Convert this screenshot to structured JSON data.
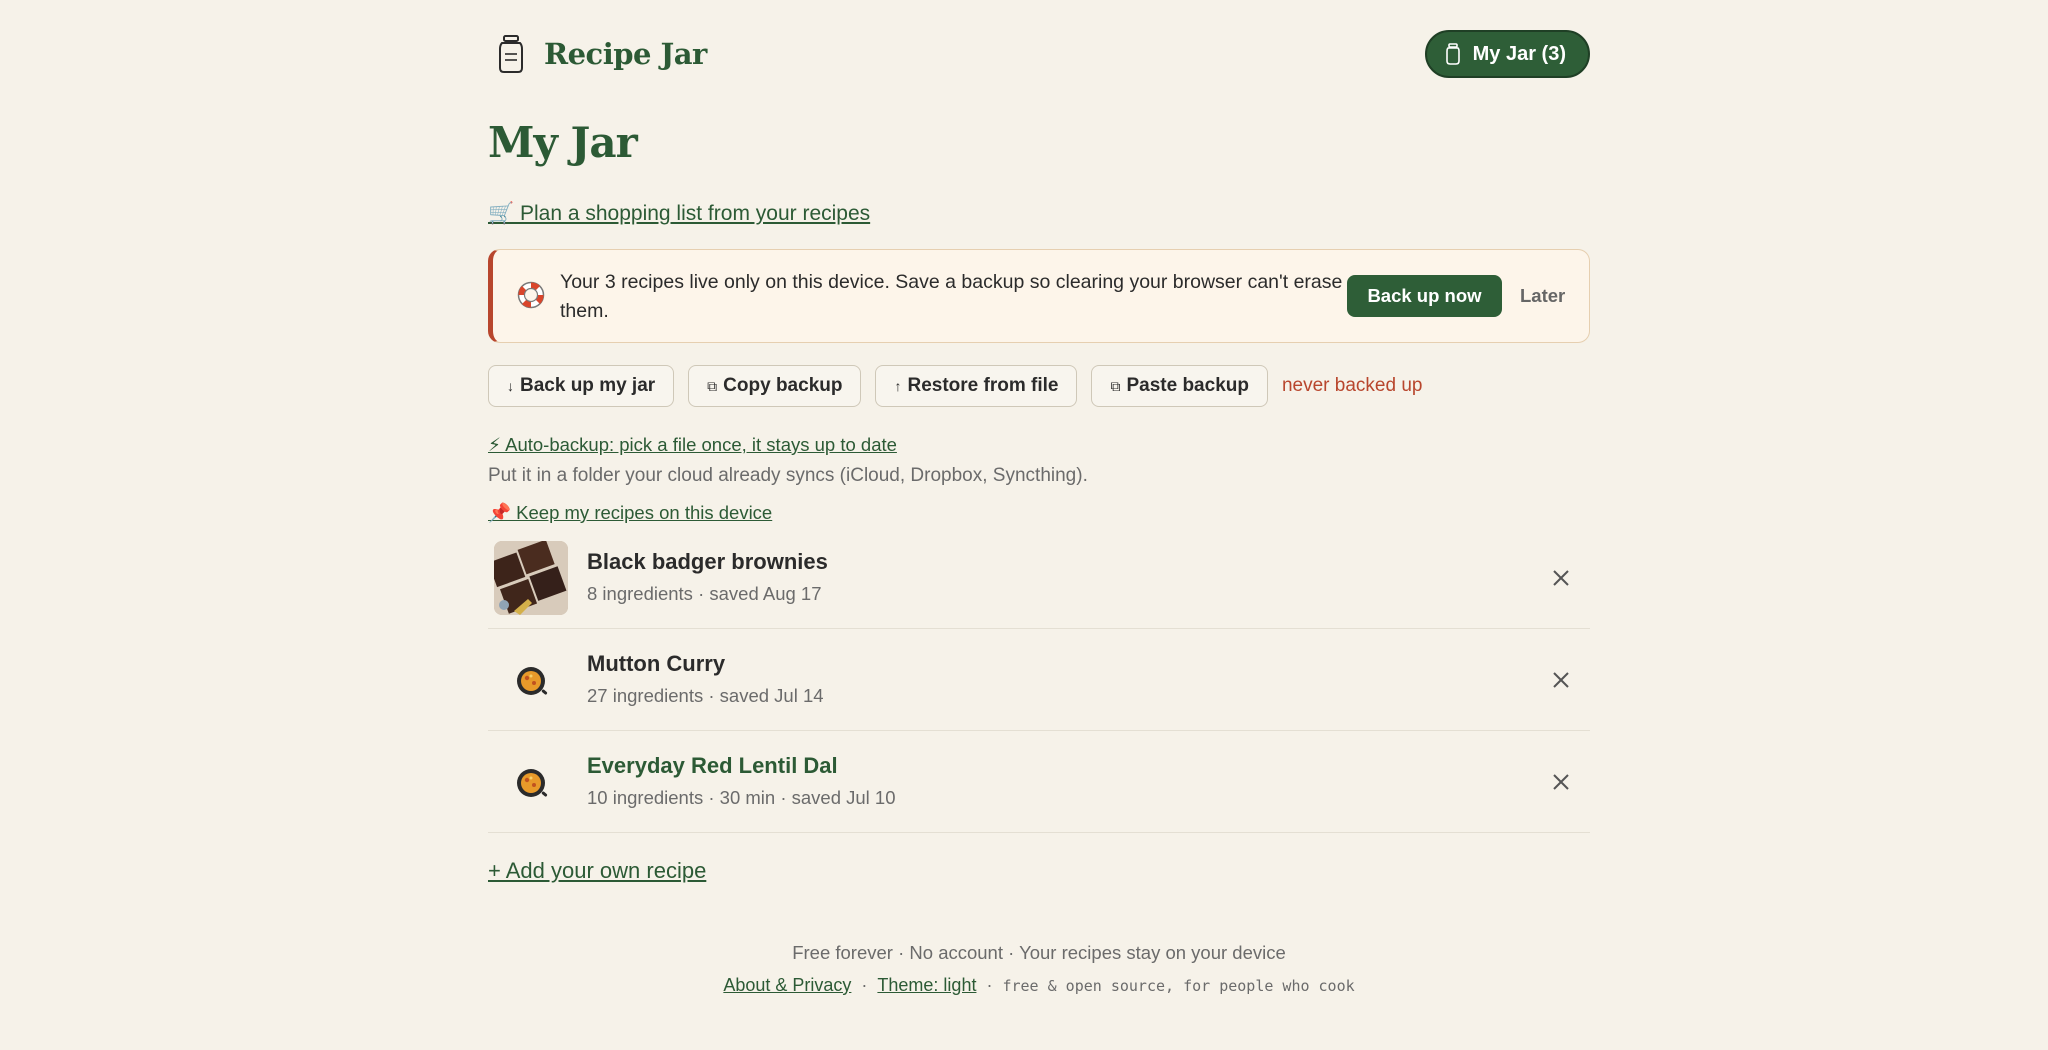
{
  "header": {
    "brand": "Recipe Jar",
    "jar_button": "My Jar (3)"
  },
  "page": {
    "title": "My Jar",
    "plan_link": "🛒 Plan a shopping list from your recipes"
  },
  "banner": {
    "text": "Your 3 recipes live only on this device. Save a backup so clearing your browser can't erase them.",
    "primary": "Back up now",
    "secondary": "Later"
  },
  "actions": {
    "backup": {
      "glyph": "↓",
      "label": "Back up my jar"
    },
    "copy": {
      "glyph": "⧉",
      "label": "Copy backup"
    },
    "restore": {
      "glyph": "↑",
      "label": "Restore from file"
    },
    "paste": {
      "glyph": "⧉",
      "label": "Paste backup"
    },
    "status": "never backed up"
  },
  "auto": {
    "link": "⚡ Auto-backup: pick a file once, it stays up to date",
    "sub": "Put it in a folder your cloud already syncs (iCloud, Dropbox, Syncthing).",
    "keep_link": "📌 Keep my recipes on this device"
  },
  "recipes": [
    {
      "title": "Black badger brownies",
      "meta": "8 ingredients · saved Aug 17",
      "image": "brownie-photo"
    },
    {
      "title": "Mutton Curry",
      "meta": "27 ingredients · saved Jul 14",
      "image": "pan-icon"
    },
    {
      "title": "Everyday Red Lentil Dal",
      "meta": "10 ingredients · 30 min · saved Jul 10",
      "image": "pan-icon"
    }
  ],
  "add_link": "+ Add your own recipe",
  "footer": {
    "line1": "Free forever · No account · Your recipes stay on your device",
    "about": "About & Privacy",
    "theme": "Theme: light",
    "sep": "·",
    "tagline": "free & open source, for people who cook"
  },
  "colors": {
    "background": "#f6f2e9",
    "brand_green": "#2e5e37",
    "warning_red": "#b8462d"
  }
}
